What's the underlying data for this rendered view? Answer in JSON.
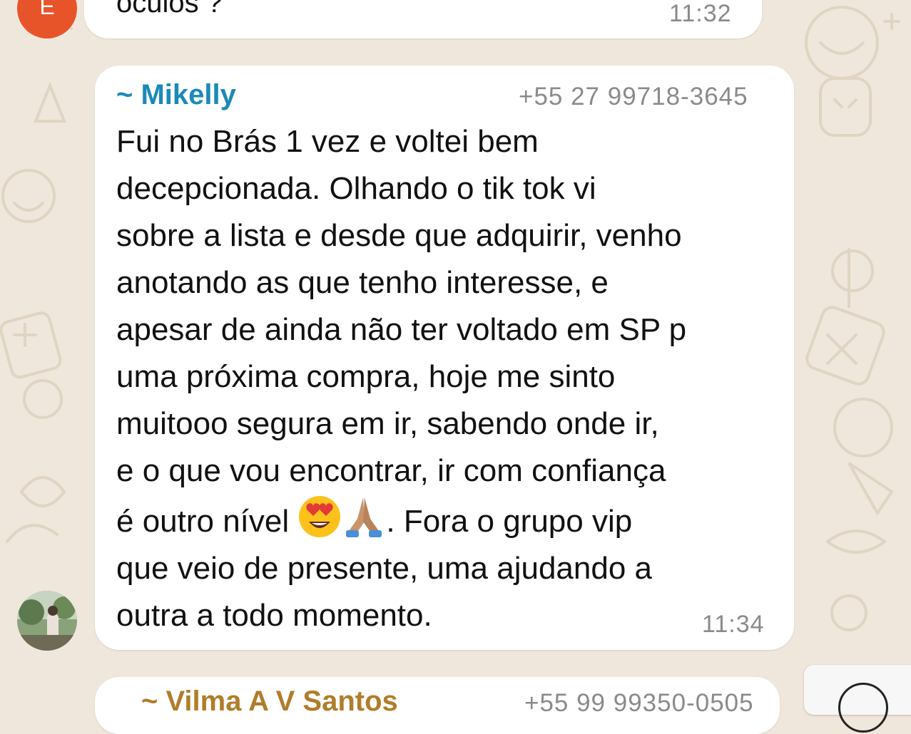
{
  "previous_message": {
    "avatar_initial": "E",
    "text_fragment": "óculos ?",
    "time": "11:32"
  },
  "message": {
    "sender_name": "~ Mikelly",
    "sender_phone": "+55 27 99718-3645",
    "lines": [
      "Fui no Brás 1 vez e voltei bem",
      "decepcionada. Olhando o tik tok vi",
      "sobre a lista e desde que adquirir, venho",
      "anotando as que tenho interesse, e",
      "apesar de ainda não ter voltado em SP p",
      "uma próxima compra, hoje me sinto",
      "muitooo segura em ir, sabendo onde ir,",
      "e o que vou encontrar, ir com confiança"
    ],
    "line_emoji_before": "é outro nível ",
    "line_emoji_after": ". Fora o grupo vip",
    "lines_end": [
      "que veio de presente, uma ajudando a",
      "outra a todo momento."
    ],
    "emojis": [
      "heart-eyes-face",
      "folded-hands"
    ],
    "time": "11:34"
  },
  "next_message": {
    "sender_name": "~ Vilma A V Santos",
    "sender_phone": "+55 99 99350-0505"
  },
  "colors": {
    "background": "#efe7dc",
    "sender_name": "#1a8ab8",
    "next_sender_name": "#b07d2a",
    "avatar_e": "#e8542a",
    "timestamp": "#8a8a8a"
  }
}
